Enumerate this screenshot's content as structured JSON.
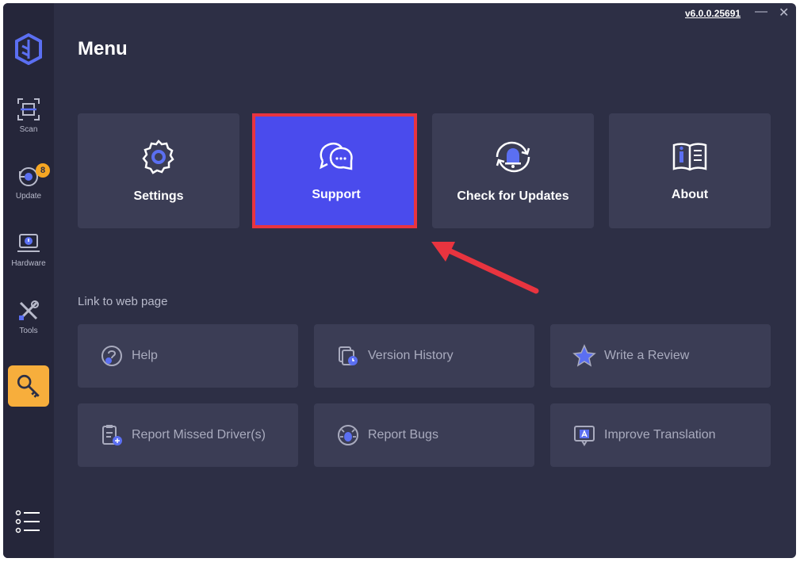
{
  "window": {
    "version": "v6.0.0.25691",
    "minimize_glyph": "—",
    "close_glyph": "✕"
  },
  "sidebar": {
    "items": [
      {
        "label": "Scan",
        "icon": "scan-icon"
      },
      {
        "label": "Update",
        "icon": "update-icon",
        "badge": "8"
      },
      {
        "label": "Hardware",
        "icon": "hardware-icon"
      },
      {
        "label": "Tools",
        "icon": "tools-icon"
      }
    ],
    "active_icon": "key-icon",
    "bottom_icon": "list-icon"
  },
  "main": {
    "title": "Menu",
    "cards": [
      {
        "label": "Settings",
        "icon": "gear-icon"
      },
      {
        "label": "Support",
        "icon": "chat-icon"
      },
      {
        "label": "Check for Updates",
        "icon": "bell-refresh-icon"
      },
      {
        "label": "About",
        "icon": "book-icon"
      }
    ],
    "links_title": "Link to web page",
    "links": [
      {
        "label": "Help",
        "icon": "help-icon"
      },
      {
        "label": "Version History",
        "icon": "version-history-icon"
      },
      {
        "label": "Write a Review",
        "icon": "star-icon"
      },
      {
        "label": "Report Missed Driver(s)",
        "icon": "report-driver-icon"
      },
      {
        "label": "Report Bugs",
        "icon": "bug-icon"
      },
      {
        "label": "Improve Translation",
        "icon": "translate-icon"
      }
    ]
  },
  "colors": {
    "accent": "#4a4bed",
    "highlight": "#e8343f",
    "active_tab": "#f7ae3c",
    "badge": "#f5a623",
    "background": "#2d2f45",
    "sidebar": "#25263a",
    "card": "#3b3d55"
  }
}
